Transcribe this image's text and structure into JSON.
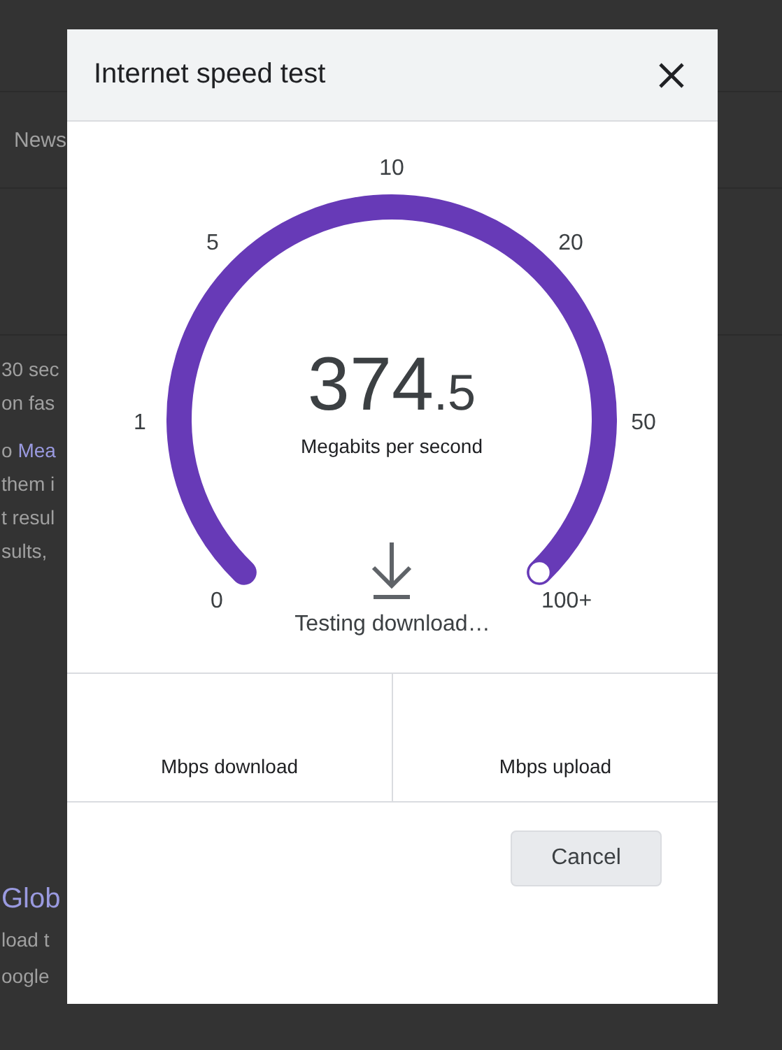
{
  "background": {
    "tab": "News",
    "lines": [
      {
        "text": "30 sec"
      },
      {
        "text": "on fas"
      },
      {
        "text": "o ",
        "link": "Mea"
      },
      {
        "text": "them i"
      },
      {
        "text": "t resul"
      },
      {
        "text": "sults,"
      }
    ],
    "result_title": "Glob",
    "result_lines": [
      "load t",
      "oogle"
    ]
  },
  "dialog": {
    "title": "Internet speed test",
    "gauge": {
      "labels": [
        "0",
        "1",
        "5",
        "10",
        "20",
        "50",
        "100+"
      ],
      "reading": "374",
      "reading_decimal": ".5",
      "unit": "Megabits per second",
      "status": "Testing download…"
    },
    "results": [
      {
        "label": "Mbps download"
      },
      {
        "label": "Mbps upload"
      }
    ],
    "buttons": [
      "Cancel"
    ]
  }
}
